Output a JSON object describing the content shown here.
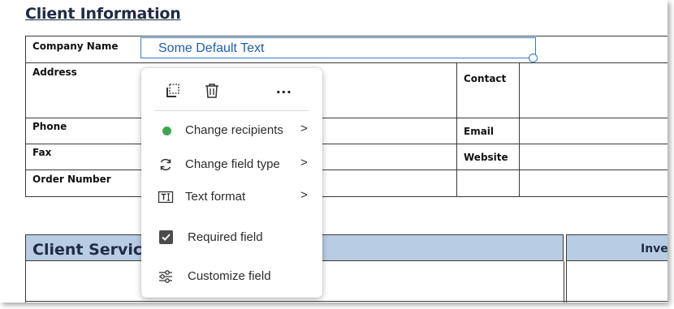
{
  "document": {
    "section_title": "Client Information",
    "field": {
      "value": "Some Default Text"
    },
    "labels": {
      "company_name": "Company Name",
      "address": "Address",
      "phone": "Phone",
      "fax": "Fax",
      "order_number": "Order Number",
      "contact": "Contact",
      "email": "Email",
      "website": "Website"
    },
    "services_title": "Client Servic",
    "invoice_title": "Inve"
  },
  "menu": {
    "toolbar": {
      "icons": [
        "copy-field-icon",
        "trash-icon",
        "more-icon"
      ],
      "more_label": "..."
    },
    "items": [
      {
        "label": "Change recipients",
        "icon": "status-dot-icon",
        "color": "#3da74e",
        "submenu": true
      },
      {
        "label": "Change field type",
        "icon": "sync-icon",
        "submenu": true
      },
      {
        "label": "Text format",
        "icon": "text-format-icon",
        "submenu": true
      },
      {
        "label": "Required field",
        "icon": "checkbox-checked-icon",
        "checked": true
      },
      {
        "label": "Customize field",
        "icon": "sliders-icon"
      }
    ],
    "chevron": ">"
  },
  "colors": {
    "field_border": "#2c7ec7",
    "header_fill": "#b8cde4",
    "title_text": "#1f2b44"
  }
}
